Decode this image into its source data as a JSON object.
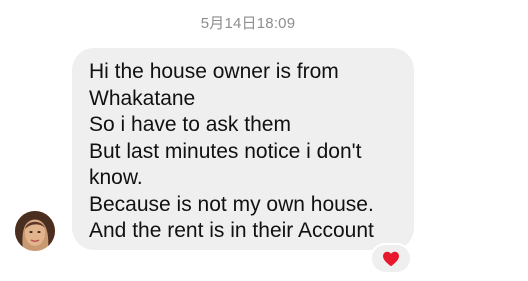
{
  "timestamp": "5月14日18:09",
  "message": {
    "lines": [
      "Hi the house owner is from",
      "Whakatane",
      "So i have to ask them",
      "But last minutes notice i don't",
      "know.",
      "Because is not my own house.",
      "And the rent is in their Account"
    ],
    "reaction_icon": "red-heart-icon"
  },
  "colors": {
    "bubble_background": "#efefef",
    "text": "#111111",
    "timestamp": "#8e8e8e",
    "reaction_heart": "#e8192c"
  }
}
